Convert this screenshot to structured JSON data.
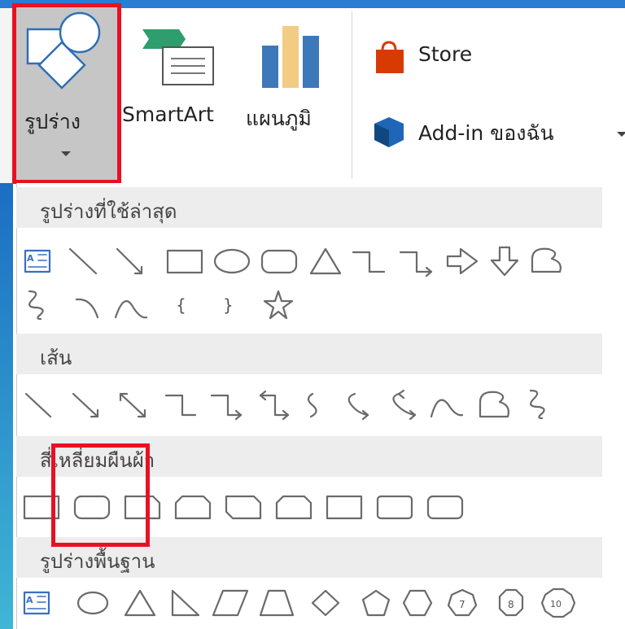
{
  "ribbon": {
    "shapes_label": "รูปร่าง",
    "smartart_label": "SmartArt",
    "chart_label": "แผนภูมิ",
    "store_label": "Store",
    "addins_label": "Add-in ของฉัน"
  },
  "gallery": {
    "recent_header": "รูปร่างที่ใช้ล่าสุด",
    "lines_header": "เส้น",
    "rectangles_header": "สี่เหลี่ยมผืนผ้า",
    "basic_header": "รูปร่างพื้นฐาน",
    "basic_numbers": [
      "7",
      "8",
      "10"
    ]
  },
  "colors": {
    "highlight": "#e81123",
    "accent_blue": "#2b7cd3",
    "selected_button": "#c6c6c6",
    "section_header": "#ededed"
  }
}
